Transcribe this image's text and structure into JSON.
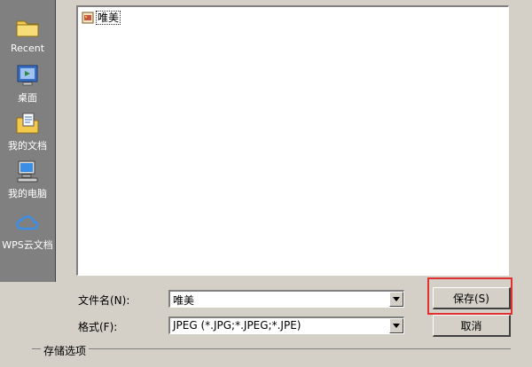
{
  "places": [
    {
      "label": "Recent",
      "icon": "folder-icon"
    },
    {
      "label": "桌面",
      "icon": "desktop-icon"
    },
    {
      "label": "我的文档",
      "icon": "my-documents-icon"
    },
    {
      "label": "我的电脑",
      "icon": "my-computer-icon"
    },
    {
      "label": "WPS云文档",
      "icon": "cloud-icon"
    }
  ],
  "files": [
    {
      "name": "唯美",
      "icon": "image-file-icon"
    }
  ],
  "filename": {
    "label": "文件名(N):",
    "value": "唯美"
  },
  "format": {
    "label": "格式(F):",
    "value": "JPEG (*.JPG;*.JPEG;*.JPE)"
  },
  "buttons": {
    "save": "保存(S)",
    "cancel": "取消"
  },
  "options_group": {
    "title": "存储选项"
  },
  "colors": {
    "highlight": "#e03030",
    "places_bg": "#808080",
    "dialog_bg": "#d4d0c8"
  }
}
